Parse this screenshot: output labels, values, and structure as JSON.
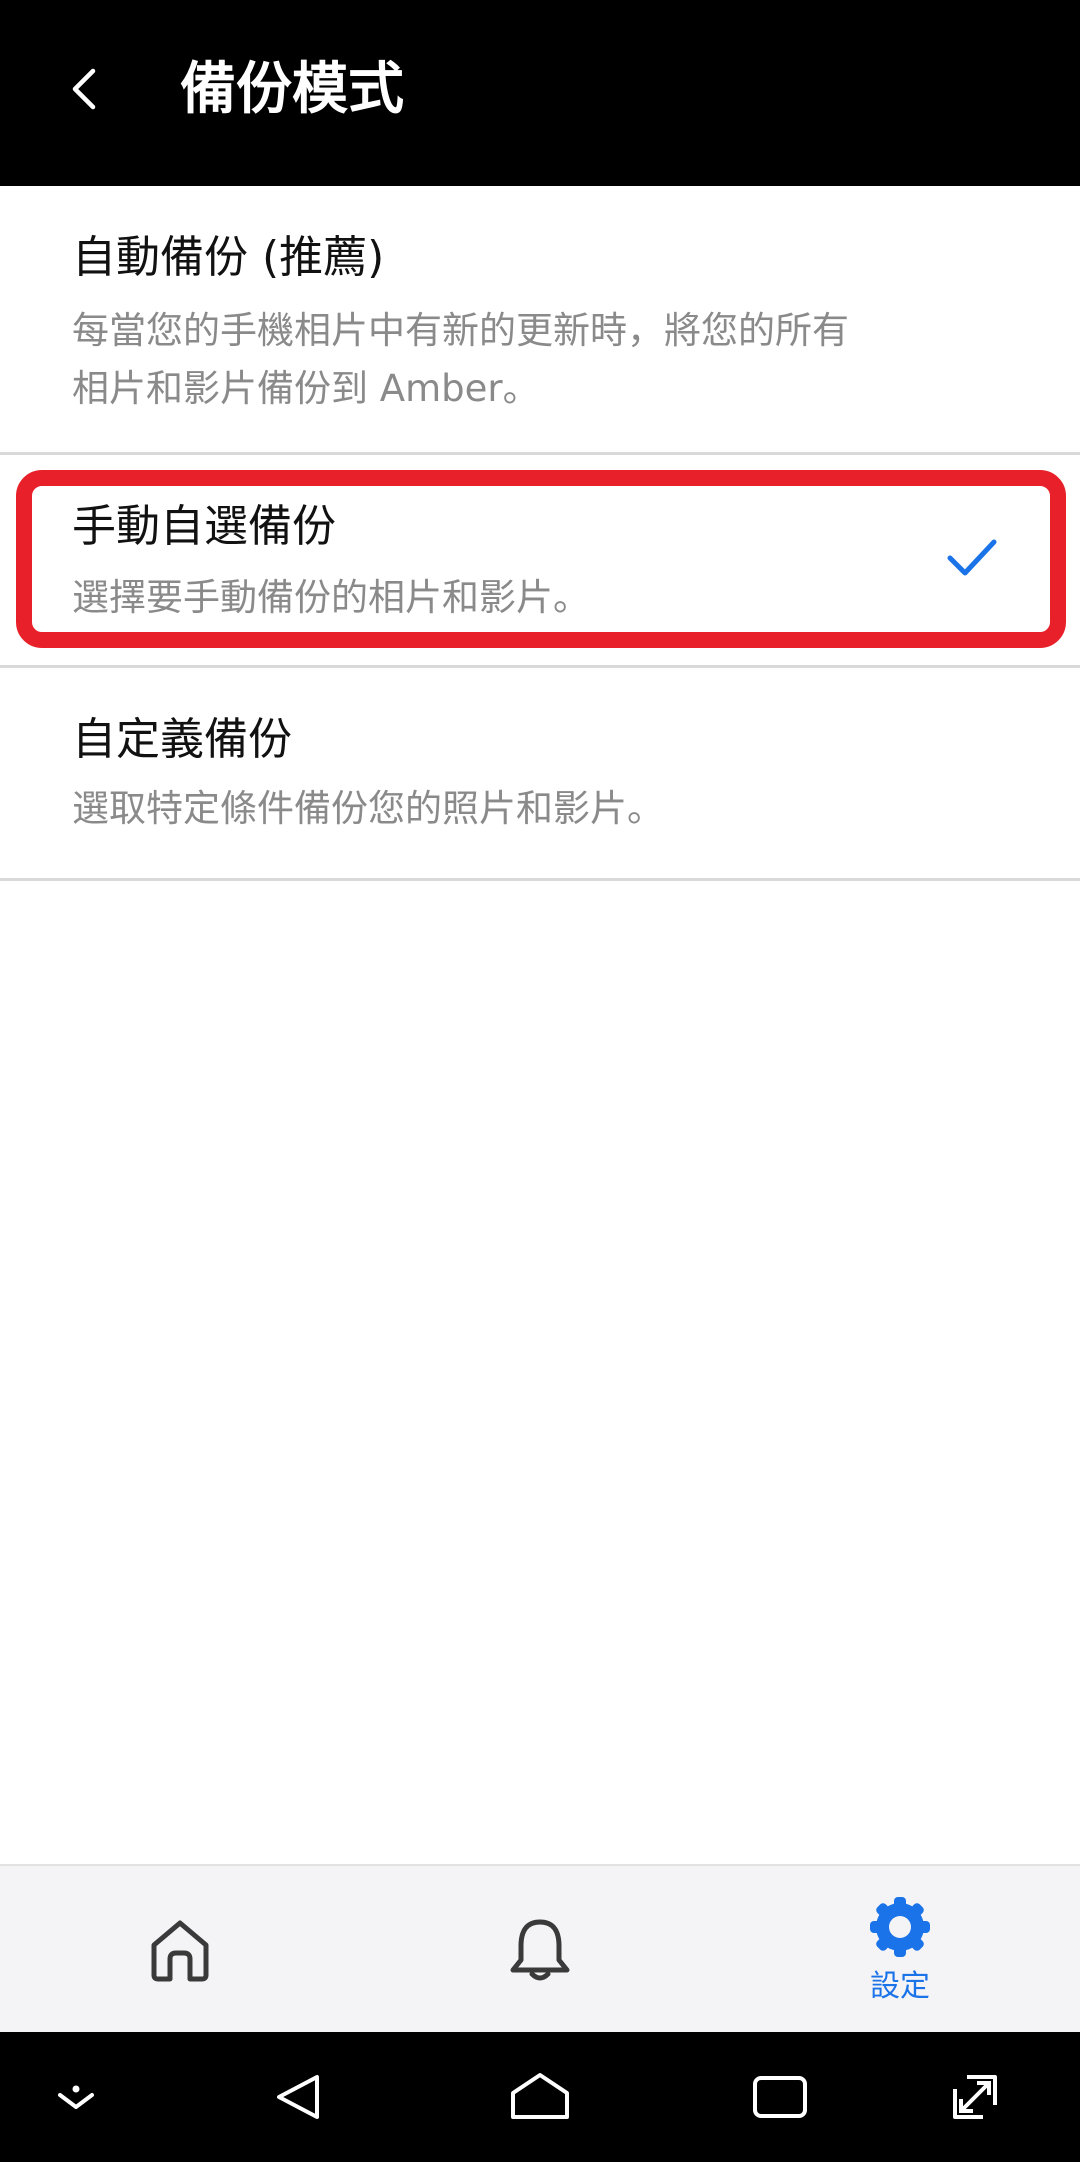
{
  "header": {
    "title": "備份模式"
  },
  "options": [
    {
      "title": "自動備份 (推薦)",
      "desc_line1": "每當您的手機相片中有新的更新時，將您的所有",
      "desc_line2": "相片和影片備份到 Amber。"
    },
    {
      "title": "手動自選備份",
      "desc_line1": "選擇要手動備份的相片和影片。",
      "selected": true
    },
    {
      "title": "自定義備份",
      "desc_line1": "選取特定條件備份您的照片和影片。"
    }
  ],
  "tabbar": {
    "settings_label": "設定"
  },
  "colors": {
    "accent": "#1a73e8",
    "highlight": "#e8202a",
    "header_bg": "#000000"
  },
  "icons": [
    "chevron-left-icon",
    "checkmark-icon",
    "home-icon",
    "bell-icon",
    "gear-icon",
    "chevron-down-icon",
    "back-triangle-icon",
    "home-nav-icon",
    "recents-icon",
    "resize-icon"
  ]
}
